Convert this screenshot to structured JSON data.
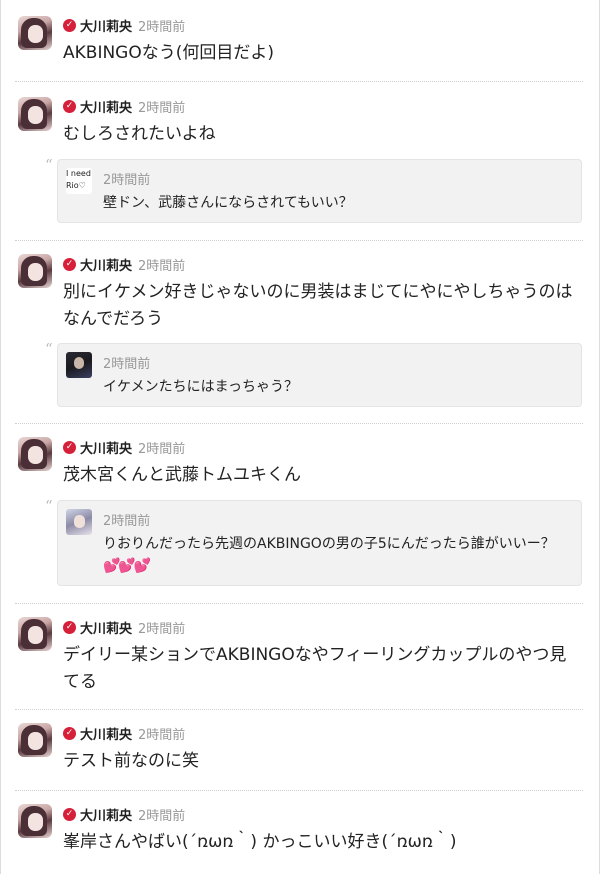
{
  "author": {
    "name": "大川莉央",
    "verified_icon": "verified-check-icon"
  },
  "posts": [
    {
      "time": "2時間前",
      "text": "AKBINGOなう(何回目だよ)"
    },
    {
      "time": "2時間前",
      "text": "むしろされたいよね",
      "reply": {
        "avatar_text": "I need Rio♡",
        "time": "2時間前",
        "text": "壁ドン、武藤さんにならされてもいい？"
      }
    },
    {
      "time": "2時間前",
      "text": "別にイケメン好きじゃないのに男装はまじてにやにやしちゃうのはなんでだろう",
      "reply": {
        "time": "2時間前",
        "text": "イケメンたちにはまっちゃう？"
      }
    },
    {
      "time": "2時間前",
      "text": "茂木宮くんと武藤トムユキくん",
      "reply": {
        "time": "2時間前",
        "text": "りおりんだったら先週のAKBINGOの男の子5にんだったら誰がいいー？",
        "hearts": "💕💕💕"
      }
    },
    {
      "time": "2時間前",
      "text": "デイリー某ションでAKBINGOなやフィーリングカップルのやつ見てる"
    },
    {
      "time": "2時間前",
      "text": "テスト前なのに笑"
    },
    {
      "time": "2時間前",
      "text": "峯岸さんやばい(´ռωռ｀) かっこいい好き(´ռωռ｀)"
    }
  ],
  "colors": {
    "verified": "#d6203a",
    "time": "#999999",
    "reply_bg": "#f2f2f2",
    "heart": "#f07fbf"
  }
}
